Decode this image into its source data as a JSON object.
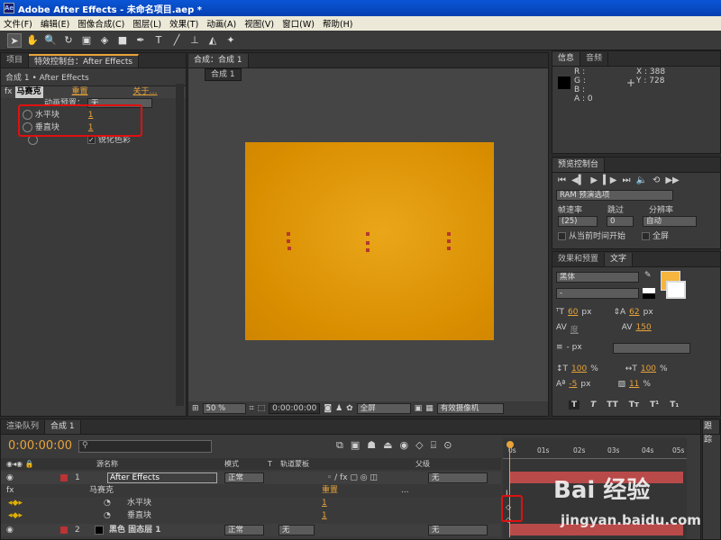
{
  "window": {
    "title": "Adobe After Effects - 未命名项目.aep *",
    "icon_text": "Ae"
  },
  "menu": [
    "文件(F)",
    "编辑(E)",
    "图像合成(C)",
    "图层(L)",
    "效果(T)",
    "动画(A)",
    "视图(V)",
    "窗口(W)",
    "帮助(H)"
  ],
  "left_panel": {
    "tabs": [
      "项目",
      "特效控制台：After Effects"
    ],
    "crumb": "合成 1 • After Effects",
    "effect": {
      "fx": "fx",
      "name": "马赛克",
      "reset": "重置",
      "about": "关于…"
    },
    "anim_preset": {
      "label": "动画预置：",
      "value": "无"
    },
    "params": [
      {
        "name": "水平块",
        "value": "1"
      },
      {
        "name": "垂直块",
        "value": "1"
      }
    ],
    "sharpen": "锐化色彩"
  },
  "comp_panel": {
    "tab": "合成：合成 1",
    "subtab": "合成 1",
    "zoom": "50 %",
    "time": "0:00:00:00",
    "res": "全屏",
    "camera": "有效摄像机",
    "canvas_color": "#e29a07"
  },
  "info_panel": {
    "tabs": [
      "信息",
      "音频"
    ],
    "channels": [
      "R :",
      "G :",
      "B :",
      "A : 0"
    ],
    "x": "X : 388",
    "y": "Y : 728"
  },
  "preview_panel": {
    "title": "预览控制台",
    "ram": "RAM 预演选项",
    "labels": [
      "帧速率",
      "跳过",
      "分辨率"
    ],
    "values": [
      "(25)",
      "0",
      "自动"
    ],
    "from_current": "从当前时间开始",
    "fullscreen": "全屏"
  },
  "text_panel": {
    "tabs": [
      "效果和预置",
      "文字"
    ],
    "font": "黑体",
    "style": "-",
    "size": "60",
    "size_unit": "px",
    "leading": "62",
    "leading_unit": "px",
    "kern": "度",
    "tracking": "150",
    "stroke": "- px",
    "vscale": "100",
    "hscale": "100",
    "pct": "%",
    "baseline": "-5",
    "baseline_unit": "px",
    "tsume": "11",
    "tsume_unit": "%",
    "styles": [
      "T",
      "T",
      "TT",
      "Tт",
      "T¹",
      "T₁"
    ],
    "fill_color": "#f5b53f"
  },
  "timeline": {
    "tabs": [
      "渲染队列",
      "合成 1"
    ],
    "time": "0:00:00:00",
    "headers": {
      "src": "源名称",
      "mode": "模式",
      "t": "T",
      "track": "轨道蒙板",
      "parent": "父级"
    },
    "ruler": [
      "0s",
      "01s",
      "02s",
      "03s",
      "04s",
      "05s"
    ],
    "layers": [
      {
        "num": "1",
        "name": "After Effects",
        "mode": "正常",
        "parent": "无"
      },
      {
        "num": "2",
        "name": "黑色 固态层 1",
        "mode": "正常",
        "track": "无",
        "parent": "无"
      }
    ],
    "effect_row": {
      "name": "马赛克",
      "reset": "重置",
      "dots": "..."
    },
    "param_rows": [
      {
        "name": "水平块",
        "value": "1"
      },
      {
        "name": "垂直块",
        "value": "1"
      }
    ],
    "right_tab": "跟踪"
  },
  "watermark": {
    "text": "Bai 经验",
    "url": "jingyan.baidu.com"
  }
}
